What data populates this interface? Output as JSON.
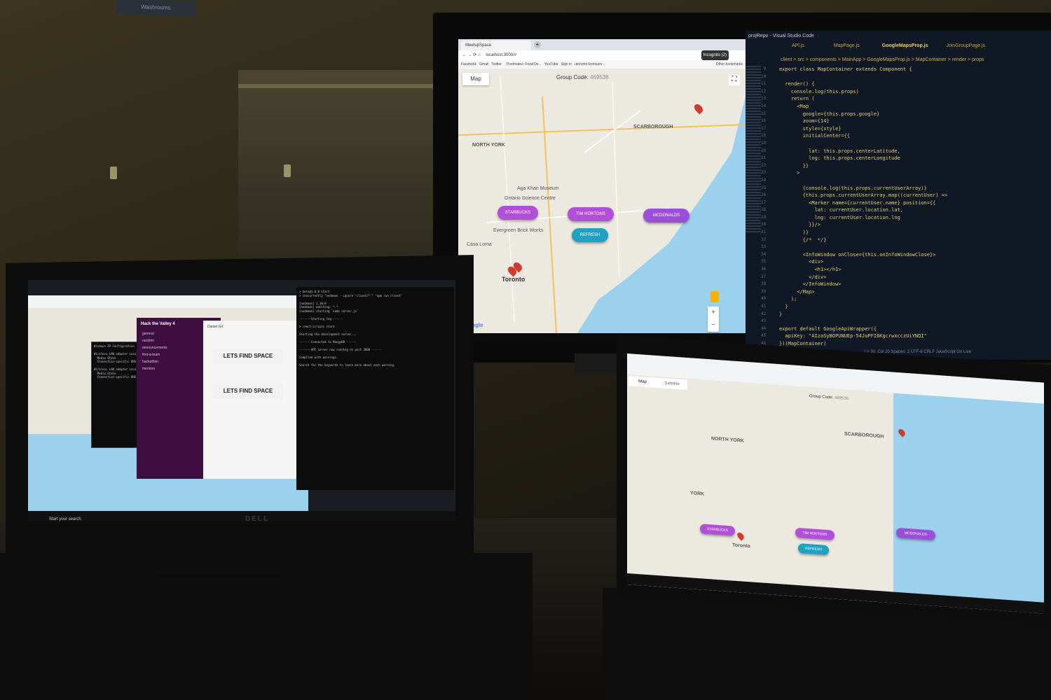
{
  "scene": {
    "description_label": "workspace-photo",
    "wall_sign": "Washrooms"
  },
  "monitor": {
    "chrome": {
      "tab_title": "MeetupSpace",
      "address": "localhost:3000/#",
      "bookmarks": [
        "Facebook",
        "Gmail",
        "Twitter",
        "Postmates: Food De...",
        "YouTube",
        "Sign in",
        "utoronto-bootcam...",
        "Other bookmarks"
      ],
      "incognito": "Incognito (2)",
      "map_button": "Map",
      "group_code_label": "Group Code:",
      "group_code": "469536",
      "places": [
        "NORTH YORK",
        "SCARBOROUGH",
        "Aga Khan Museum",
        "Ontario Science Centre",
        "Evergreen Brick Works",
        "Casa Loma",
        "Toronto"
      ],
      "pills": [
        {
          "label": "STARBUCKS",
          "color": "#b24fd9"
        },
        {
          "label": "TIM HORTONS",
          "color": "#b24fd9"
        },
        {
          "label": "MCDONALDS",
          "color": "#9b4fd9"
        },
        {
          "label": "REFRESH",
          "color": "#1fa2c2"
        }
      ],
      "google_logo": "Google"
    },
    "vscode": {
      "title": "projRepo - Visual Studio Code",
      "tabs": [
        "APl.js",
        "MapPage.js",
        "GoogleMapsProp.js",
        "JoinGroupPage.js"
      ],
      "breadcrumb": "client > src > components > MainApp > GoogleMapsProp.js > MapContainer > render > props",
      "line_numbers": "9\n10\n11\n12\n13\n14\n15\n16\n17\n18\n19\n20\n21\n22\n23\n24\n25\n26\n27\n28\n29\n30\n31\n32\n33\n34\n35\n36\n37\n38\n39\n40\n41\n42\n43\n44\n45\n46",
      "code": "export class MapContainer extends Component {\n\n  render() {\n    console.log(this.props)\n    return (\n      <Map\n        google={this.props.google}\n        zoom={14}\n        style={style}\n        initialCenter={{\n\n          lat: this.props.centerLatitude,\n          lng: this.props.centerLongitude\n        }}\n      >\n\n        {console.log(this.props.currentUserArray)}\n        {this.props.currentUserArray.map((currentUser) =>\n          <Marker name={currentUser.name} position={{\n            lat: currentUser.location.lat,\n            lng: currentUser.location.lng\n          }}/>\n        )}\n        {/*  */}\n\n        <InfoWindow onClose={this.onInfoWindowClose}>\n          <div>\n            <h1></h1>\n          </div>\n        </InfoWindow>\n      </Map>\n    );\n  }\n}\n\nexport default GoogleApiWrapper({\n  apiKey: \"AIzaSyBOPUNUEp-54JoPFI6KgcrwxcczUiYNQI\"\n})(MapContainer)",
      "status": "Ln 30, Col 20    Spaces: 2    UTF-8    CRLF    JavaScript    Go Live"
    }
  },
  "laptop_left": {
    "brand": "DELL",
    "slack": {
      "workspace": "Hack the Valley 4",
      "channels": [
        "general",
        "random",
        "announcements",
        "find-a-team",
        "hackathon",
        "mentors"
      ],
      "message_author": "Daniel Gil",
      "banner": "LETS FIND SPACE"
    },
    "taskbar_search": "Start your search"
  },
  "laptop_right": {
    "chrome": {
      "map_button": "Map",
      "satellite_button": "Satellite",
      "group_code_label": "Group Code:",
      "group_code": "469536",
      "places": [
        "NORTH YORK",
        "SCARBOROUGH",
        "YORK",
        "Toronto"
      ],
      "pills": [
        {
          "label": "STARBUCKS",
          "color": "#b24fd9"
        },
        {
          "label": "TIM HORTONS",
          "color": "#b24fd9"
        },
        {
          "label": "MCDONALDS",
          "color": "#9b4fd9"
        },
        {
          "label": "REFRESH",
          "color": "#1fa2c2"
        }
      ]
    }
  }
}
